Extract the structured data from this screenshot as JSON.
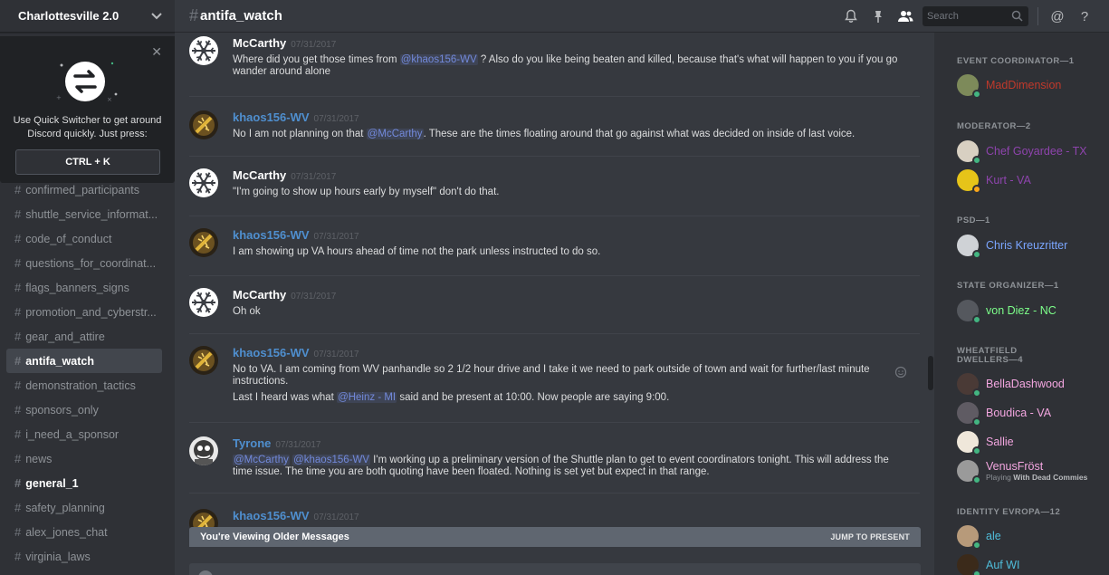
{
  "server": {
    "name": "Charlottesville 2.0"
  },
  "quick_switcher": {
    "text": "Use Quick Switcher to get around Discord quickly. Just press:",
    "shortcut": "CTRL + K"
  },
  "channels": [
    {
      "name": "confirmed_participants",
      "state": "normal"
    },
    {
      "name": "shuttle_service_informat...",
      "state": "normal"
    },
    {
      "name": "code_of_conduct",
      "state": "normal"
    },
    {
      "name": "questions_for_coordinat...",
      "state": "normal"
    },
    {
      "name": "flags_banners_signs",
      "state": "normal"
    },
    {
      "name": "promotion_and_cyberstr...",
      "state": "normal"
    },
    {
      "name": "gear_and_attire",
      "state": "normal"
    },
    {
      "name": "antifa_watch",
      "state": "active"
    },
    {
      "name": "demonstration_tactics",
      "state": "normal"
    },
    {
      "name": "sponsors_only",
      "state": "normal"
    },
    {
      "name": "i_need_a_sponsor",
      "state": "normal"
    },
    {
      "name": "news",
      "state": "normal"
    },
    {
      "name": "general_1",
      "state": "unread"
    },
    {
      "name": "safety_planning",
      "state": "normal"
    },
    {
      "name": "alex_jones_chat",
      "state": "normal"
    },
    {
      "name": "virginia_laws",
      "state": "normal"
    }
  ],
  "header": {
    "channel": "antifa_watch",
    "search_placeholder": "Search"
  },
  "messages": [
    {
      "author": "McCarthy",
      "author_color": "#ffffff",
      "avatar": "snowflake-avatar",
      "time": "07/31/2017",
      "paragraphs": [
        [
          {
            "t": "Where did you get those times from "
          },
          {
            "m": "@khaos156-WV"
          },
          {
            "t": " ? Also do you like being beaten and killed, because that's what will happen to you if you go wander around alone"
          }
        ]
      ]
    },
    {
      "author": "khaos156-WV",
      "author_color": "#4f8fcf",
      "avatar": "gold-emblem-avatar",
      "time": "07/31/2017",
      "paragraphs": [
        [
          {
            "t": "No I am not planning on that "
          },
          {
            "m": "@McCarthy"
          },
          {
            "t": ". These are the times floating around that go against what was decided on inside of last voice."
          }
        ]
      ]
    },
    {
      "author": "McCarthy",
      "author_color": "#ffffff",
      "avatar": "snowflake-avatar",
      "time": "07/31/2017",
      "paragraphs": [
        [
          {
            "t": "\"I'm going to show up hours early by myself\" don't do that."
          }
        ]
      ]
    },
    {
      "author": "khaos156-WV",
      "author_color": "#4f8fcf",
      "avatar": "gold-emblem-avatar",
      "time": "07/31/2017",
      "paragraphs": [
        [
          {
            "t": "I am showing up VA hours ahead of time not the park unless instructed to do so."
          }
        ]
      ]
    },
    {
      "author": "McCarthy",
      "author_color": "#ffffff",
      "avatar": "snowflake-avatar",
      "time": "07/31/2017",
      "paragraphs": [
        [
          {
            "t": "Oh ok"
          }
        ]
      ]
    },
    {
      "author": "khaos156-WV",
      "author_color": "#4f8fcf",
      "avatar": "gold-emblem-avatar",
      "time": "07/31/2017",
      "paragraphs": [
        [
          {
            "t": "No to VA. I am coming from WV panhandle so 2 1/2 hour drive and I take it we need to park outside of town and wait for further/last minute instructions."
          }
        ],
        [
          {
            "t": "Last I heard was what "
          },
          {
            "m": "@Heinz - MI"
          },
          {
            "t": " said and be present at 10:00. Now people are saying 9:00."
          }
        ]
      ]
    },
    {
      "author": "Tyrone",
      "author_color": "#4f8fcf",
      "avatar": "pepe-avatar",
      "time": "07/31/2017",
      "paragraphs": [
        [
          {
            "m": "@McCarthy"
          },
          {
            "t": " "
          },
          {
            "m": "@khaos156-WV"
          },
          {
            "t": " I'm working up a preliminary version of the Shuttle plan to get to event coordinators tonight. This will address the time issue. The time you are both quoting have been floated. Nothing is set yet but expect in that range."
          }
        ]
      ]
    },
    {
      "author": "khaos156-WV",
      "author_color": "#4f8fcf",
      "avatar": "gold-emblem-avatar",
      "time": "07/31/2017",
      "paragraphs": []
    }
  ],
  "older_bar": {
    "label": "You're Viewing Older Messages",
    "jump": "JUMP TO PRESENT"
  },
  "member_groups": [
    {
      "role": "EVENT COORDINATOR—1",
      "members": [
        {
          "name": "MadDimension",
          "color": "#c0392b",
          "avatar": "landscape-avatar",
          "status": "online"
        }
      ]
    },
    {
      "role": "MODERATOR—2",
      "members": [
        {
          "name": "Chef Goyardee - TX",
          "color": "#8e44ad",
          "avatar": "can-avatar",
          "status": "online"
        },
        {
          "name": "Kurt - VA",
          "color": "#8e44ad",
          "avatar": "yellow-face-avatar",
          "status": "idle"
        }
      ]
    },
    {
      "role": "PSD—1",
      "members": [
        {
          "name": "Chris Kreuzritter",
          "color": "#7aa5ff",
          "avatar": "helmet-avatar",
          "status": "online"
        }
      ]
    },
    {
      "role": "STATE ORGANIZER—1",
      "members": [
        {
          "name": "von Diez - NC",
          "color": "#7dff8a",
          "avatar": "dark-figure-avatar",
          "status": "online"
        }
      ]
    },
    {
      "role": "WHEATFIELD DWELLERS—4",
      "members": [
        {
          "name": "BellaDashwood",
          "color": "#f3a6e0",
          "avatar": "portrait-avatar",
          "status": "online"
        },
        {
          "name": "Boudica - VA",
          "color": "#f3a6e0",
          "avatar": "warrior-avatar",
          "status": "online"
        },
        {
          "name": "Sallie",
          "color": "#f3a6e0",
          "avatar": "statue-avatar",
          "status": "online"
        },
        {
          "name": "VenusFröst",
          "color": "#f3a6e0",
          "avatar": "bw-portrait-avatar",
          "status": "online",
          "playing_prefix": "Playing ",
          "playing": "With Dead Commies"
        }
      ]
    },
    {
      "role": "IDENTITY EVROPA—12",
      "members": [
        {
          "name": "ale",
          "color": "#4fbcd9",
          "avatar": "man-avatar",
          "status": "online"
        },
        {
          "name": "Auf WI",
          "color": "#4fbcd9",
          "avatar": "dark-avatar",
          "status": "online"
        }
      ]
    }
  ],
  "colors": {
    "online": "#43b581",
    "idle": "#faa61a",
    "mention": "#7289da"
  }
}
